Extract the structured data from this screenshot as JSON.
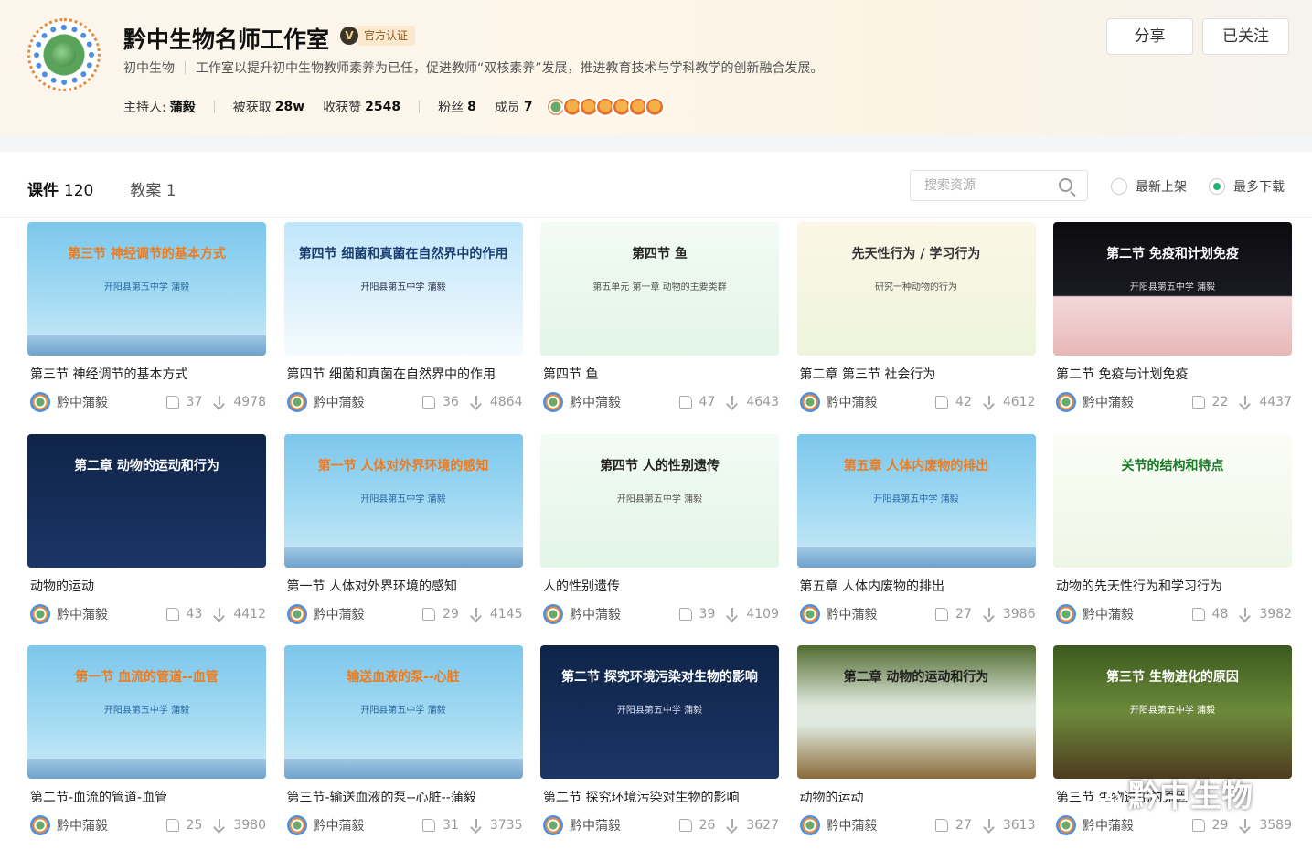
{
  "header": {
    "title": "黔中生物名师工作室",
    "verified_badge": "V",
    "verified_label": "官方认证",
    "category": "初中生物",
    "description": "工作室以提升初中生物教师素养为已任，促进教师“双核素养”发展，推进教育技术与学科教学的创新融合发展。",
    "host_label": "主持人:",
    "host_name": "蒲毅",
    "obtained_label": "被获取",
    "obtained_value": "28w",
    "likes_label": "收获赞",
    "likes_value": "2548",
    "fans_label": "粉丝",
    "fans_value": "8",
    "members_label": "成员",
    "members_value": "7",
    "share_button": "分享",
    "follow_button": "已关注"
  },
  "toolbar": {
    "tabs": [
      {
        "label": "课件",
        "count": "120",
        "active": true
      },
      {
        "label": "教案",
        "count": "1",
        "active": false
      }
    ],
    "search_placeholder": "搜索资源",
    "sort_options": [
      {
        "label": "最新上架",
        "selected": false
      },
      {
        "label": "最多下载",
        "selected": true
      }
    ]
  },
  "cards": [
    {
      "title": "第三节 神经调节的基本方式",
      "thumb_text": "第三节 神经调节的基本方式",
      "thumb_sub": "开阳县第五中学 蒲毅",
      "author": "黔中蒲毅",
      "likes": "37",
      "downloads": "4978",
      "theme": "blue"
    },
    {
      "title": "第四节 细菌和真菌在自然界中的作用",
      "thumb_text": "第四节 细菌和真菌在自然界中的作用",
      "thumb_sub": "开阳县第五中学 蒲毅",
      "author": "黔中蒲毅",
      "likes": "36",
      "downloads": "4864",
      "theme": "sky"
    },
    {
      "title": "第四节 鱼",
      "thumb_text": "第四节 鱼",
      "thumb_sub": "第五单元 第一章 动物的主要类群",
      "author": "黔中蒲毅",
      "likes": "47",
      "downloads": "4643",
      "theme": "light"
    },
    {
      "title": "第二章 第三节 社会行为",
      "thumb_text": "先天性行为 / 学习行为",
      "thumb_sub": "研究一种动物的行为",
      "author": "黔中蒲毅",
      "likes": "42",
      "downloads": "4612",
      "theme": "paper"
    },
    {
      "title": "第二节 免疫与计划免疫",
      "thumb_text": "第二节 免疫和计划免疫",
      "thumb_sub": "开阳县第五中学 蒲毅",
      "author": "黔中蒲毅",
      "likes": "22",
      "downloads": "4437",
      "theme": "dark"
    },
    {
      "title": "动物的运动",
      "thumb_text": "第二章 动物的运动和行为",
      "thumb_sub": "",
      "author": "黔中蒲毅",
      "likes": "43",
      "downloads": "4412",
      "theme": "navy"
    },
    {
      "title": "第一节 人体对外界环境的感知",
      "thumb_text": "第一节 人体对外界环境的感知",
      "thumb_sub": "开阳县第五中学 蒲毅",
      "author": "黔中蒲毅",
      "likes": "29",
      "downloads": "4145",
      "theme": "blue"
    },
    {
      "title": "人的性别遗传",
      "thumb_text": "第四节 人的性别遗传",
      "thumb_sub": "开阳县第五中学 蒲毅",
      "author": "黔中蒲毅",
      "likes": "39",
      "downloads": "4109",
      "theme": "light"
    },
    {
      "title": "第五章 人体内废物的排出",
      "thumb_text": "第五章 人体内废物的排出",
      "thumb_sub": "开阳县第五中学 蒲毅",
      "author": "黔中蒲毅",
      "likes": "27",
      "downloads": "3986",
      "theme": "blue"
    },
    {
      "title": "动物的先天性行为和学习行为",
      "thumb_text": "关节的结构和特点",
      "thumb_sub": "",
      "author": "黔中蒲毅",
      "likes": "48",
      "downloads": "3982",
      "theme": "white"
    },
    {
      "title": "第二节-血流的管道-血管",
      "thumb_text": "第一节 血流的管道--血管",
      "thumb_sub": "开阳县第五中学 蒲毅",
      "author": "黔中蒲毅",
      "likes": "25",
      "downloads": "3980",
      "theme": "blue"
    },
    {
      "title": "第三节-输送血液的泵--心脏--蒲毅",
      "thumb_text": "输送血液的泵--心脏",
      "thumb_sub": "开阳县第五中学 蒲毅",
      "author": "黔中蒲毅",
      "likes": "31",
      "downloads": "3735",
      "theme": "blue"
    },
    {
      "title": "第二节 探究环境污染对生物的影响",
      "thumb_text": "第二节 探究环境污染对生物的影响",
      "thumb_sub": "开阳县第五中学 蒲毅",
      "author": "黔中蒲毅",
      "likes": "26",
      "downloads": "3627",
      "theme": "navy"
    },
    {
      "title": "动物的运动",
      "thumb_text": "第二章 动物的运动和行为",
      "thumb_sub": "",
      "author": "黔中蒲毅",
      "likes": "27",
      "downloads": "3613",
      "theme": "green"
    },
    {
      "title": "第三节 生物进化的原因",
      "thumb_text": "第三节 生物进化的原因",
      "thumb_sub": "开阳县第五中学 蒲毅",
      "author": "黔中蒲毅",
      "likes": "29",
      "downloads": "3589",
      "theme": "forest"
    }
  ],
  "watermark": "黔中生物",
  "colors": {
    "accent": "#23b574",
    "tab_highlight": "#4ccf96",
    "verified_bg": "#fbe9cf"
  }
}
